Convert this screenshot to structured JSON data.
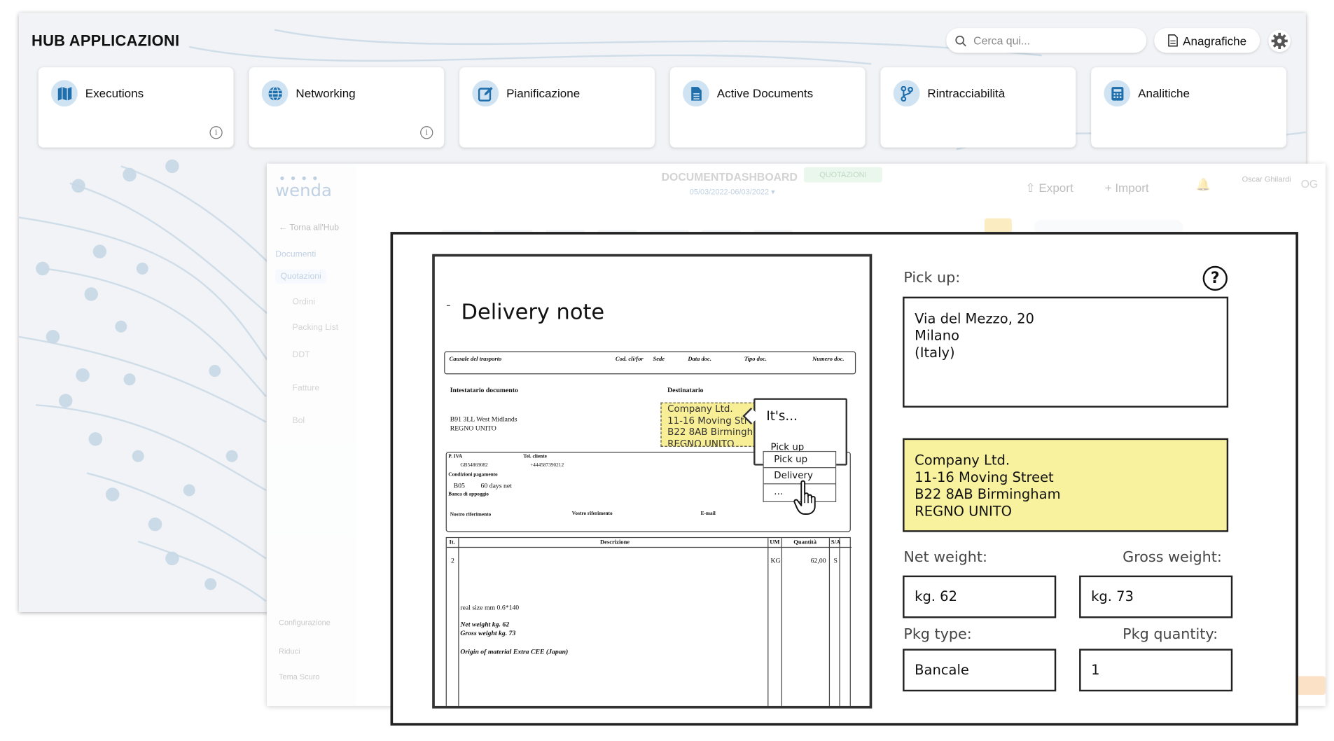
{
  "hub": {
    "title": "HUB APPLICAZIONI",
    "search_placeholder": "Cerca qui...",
    "anagrafiche_label": "Anagrafiche",
    "cards": [
      {
        "label": "Executions",
        "icon": "map-icon"
      },
      {
        "label": "Networking",
        "icon": "globe-icon"
      },
      {
        "label": "Pianificazione",
        "icon": "edit-icon"
      },
      {
        "label": "Active Documents",
        "icon": "document-icon"
      },
      {
        "label": "Rintracciabilità",
        "icon": "branch-icon"
      },
      {
        "label": "Analitiche",
        "icon": "calculator-icon"
      }
    ],
    "accent": "#1f6fad"
  },
  "wenda": {
    "logo": "wenda",
    "back_label": "Torna all'Hub",
    "section_label": "Documenti",
    "nav": [
      "Quotazioni",
      "Ordini",
      "Packing List",
      "DDT",
      "Fatture",
      "Bol"
    ],
    "bottom": [
      "Configurazione",
      "Riduci",
      "Tema Scuro"
    ],
    "title_bold": "DOCUMENT",
    "title_rest": "DASHBOARD",
    "date_range": "05/03/2022-06/03/2022 ▾",
    "badge": "QUOTAZIONI",
    "export_label": "Export",
    "import_label": "Import",
    "user_name": "Oscar Ghilardi",
    "user_initials": "OG"
  },
  "doc": {
    "title": "Delivery note",
    "header_fields": [
      "Causale del trasporto",
      "Cod. cli/for",
      "Sede",
      "Data doc.",
      "Tipo doc.",
      "Numero doc."
    ],
    "intestatario_label": "Intestatario documento",
    "intestatario_lines": [
      "B91 3LL  West Midlands",
      "REGNO UNITO"
    ],
    "destinatario_label": "Destinatario",
    "piva_label": "P. IVA",
    "piva_value": "GB54869082",
    "tel_label": "Tel. cliente",
    "tel_value": "+444587390212",
    "cond_label": "Condizioni pagamento",
    "cond_code": "B05",
    "cond_value": "60 days net",
    "banca_label": "Banca di appoggio",
    "nostro_rif": "Nostro riferimento",
    "vostro_rif": "Vostro riferimento",
    "email_label": "E-mail",
    "table_headers": [
      "It.",
      "Descrizione",
      "UM",
      "Quantità",
      "S/A"
    ],
    "row": {
      "it": "2",
      "um": "KG",
      "qty": "62,00",
      "sa": "S"
    },
    "notes": [
      "real size mm 0.6*140",
      "Net weight kg. 62",
      "Gross weight kg. 73",
      "Origin of material Extra CEE (Japan)"
    ],
    "highlight_lines": [
      "Company Ltd.",
      "11-16 Moving Str",
      "B22 8AB  Birmingh",
      "REGNO UNITO"
    ],
    "popup_title": "It's...",
    "popup_selected": "Pick up",
    "popup_options": [
      "Pick up",
      "Delivery",
      "..."
    ]
  },
  "form": {
    "pickup_label": "Pick up:",
    "pickup_lines": [
      "Via del Mezzo, 20",
      "Milano",
      "(Italy)"
    ],
    "delivery_lines": [
      "Company Ltd.",
      "11-16 Moving Street",
      "B22 8AB  Birmingham",
      "REGNO UNITO"
    ],
    "net_weight_label": "Net weight:",
    "gross_weight_label": "Gross weight:",
    "net_weight_value": "kg. 62",
    "gross_weight_value": "kg. 73",
    "pkg_type_label": "Pkg type:",
    "pkg_quantity_label": "Pkg quantity:",
    "pkg_type_value": "Bancale",
    "pkg_quantity_value": "1",
    "help_symbol": "?",
    "highlight_color": "#f8f19e"
  }
}
